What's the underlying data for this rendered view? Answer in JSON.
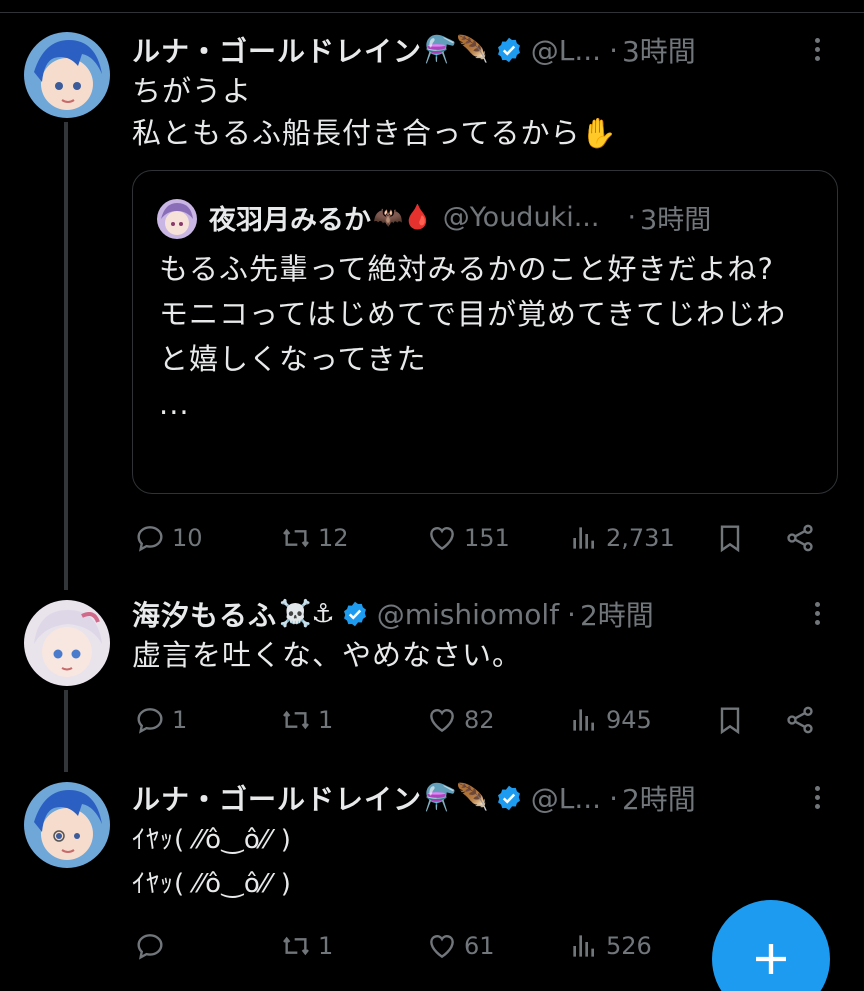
{
  "tweets": [
    {
      "name": "ルナ・ゴールドレイン",
      "emojis": "⚗️🪶",
      "handle": "@L...",
      "dot": "·",
      "time": "3時間",
      "text": "ちがうよ\n私ともるふ船長付き合ってるから✋",
      "actions": {
        "replies": "10",
        "retweets": "12",
        "likes": "151",
        "views": "2,731"
      },
      "quote": {
        "name": "夜羽月みるか",
        "emojis": "🦇🩸",
        "handle": "@Youduki...",
        "dot": "·",
        "time": "3時間",
        "text": "もるふ先輩って絶対みるかのこと好きだよね?\nモニコってはじめてで目が覚めてきてじわじわと嬉しくなってきた\n..."
      }
    },
    {
      "name": "海汐もるふ",
      "emojis": "☠️⚓",
      "handle": "@mishiomolf",
      "dot": "·",
      "time": "2時間",
      "text": "虚言を吐くな、やめなさい。",
      "actions": {
        "replies": "1",
        "retweets": "1",
        "likes": "82",
        "views": "945"
      }
    },
    {
      "name": "ルナ・ゴールドレイン",
      "emojis": "⚗️🪶",
      "handle": "@L...",
      "dot": "·",
      "time": "2時間",
      "text": "ｲﾔｯ( ⁄⁄ô‿ô⁄⁄ )\nｲﾔｯ( ⁄⁄ô‿ô⁄⁄ )",
      "actions": {
        "replies": "",
        "retweets": "1",
        "likes": "61",
        "views": "526"
      }
    }
  ],
  "icons": {
    "verified": "verified-badge-icon",
    "reply": "reply-icon",
    "retweet": "retweet-icon",
    "like": "heart-icon",
    "views": "views-chart-icon",
    "bookmark": "bookmark-icon",
    "share": "share-icon",
    "compose": "plus-icon"
  },
  "colors": {
    "background": "#000000",
    "text": "#e7e9ea",
    "muted": "#71767b",
    "accent": "#1d9bf0",
    "border": "#2f3336"
  }
}
